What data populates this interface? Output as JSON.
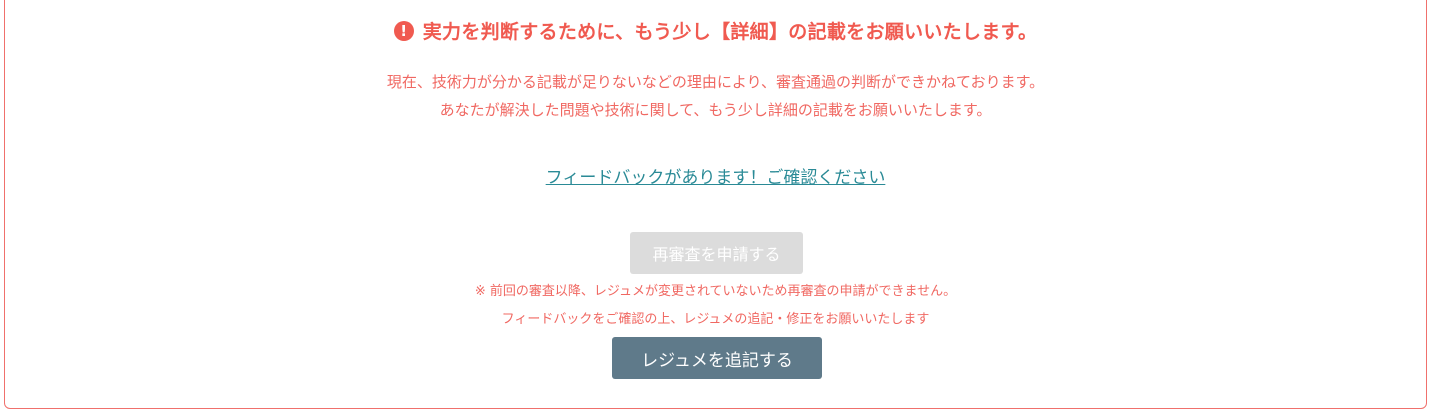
{
  "alert": {
    "icon": "exclamation-circle-icon",
    "title": "実力を判断するために、もう少し【詳細】の記載をお願いいたします。",
    "description_line1": "現在、技術力が分かる記載が足りないなどの理由により、審査通過の判断ができかねております。",
    "description_line2": "あなたが解決した問題や技術に関して、もう少し詳細の記載をお願いいたします。"
  },
  "feedback_link": {
    "label": "フィードバックがあります！ご確認ください"
  },
  "rereview_button": {
    "label": "再審査を申請する",
    "disabled": true
  },
  "notes": {
    "line1": "※ 前回の審査以降、レジュメが変更されていないため再審査の申請ができません。",
    "line2": "フィードバックをご確認の上、レジュメの追記・修正をお願いいたします"
  },
  "append_button": {
    "label": "レジュメを追記する"
  },
  "colors": {
    "accent_red": "#f05a50",
    "border_red": "#f0706c",
    "link_teal": "#2a8a96",
    "primary_button": "#5f7a8a",
    "disabled_button": "#dcdcdc"
  }
}
